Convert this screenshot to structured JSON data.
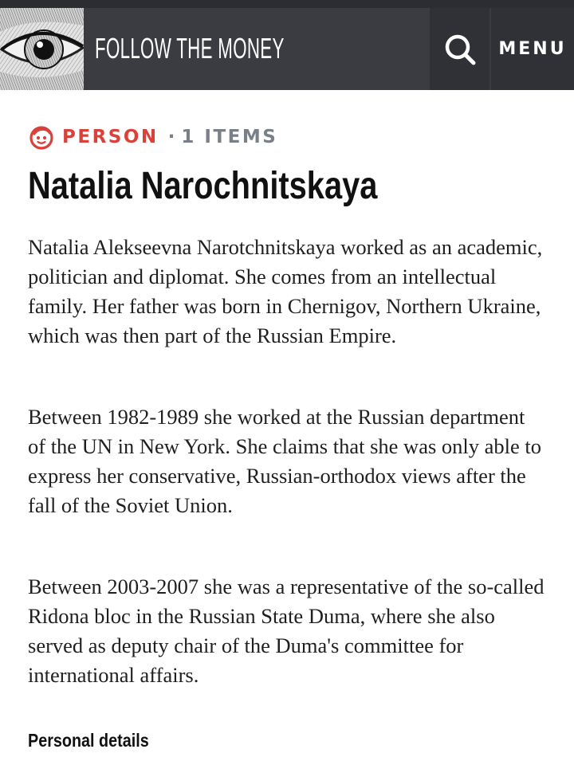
{
  "header": {
    "site_title": "FOLLOW THE MONEY",
    "search_icon": "search-icon",
    "menu_label": "MENU",
    "logo_image": "eye-banknote-engraving",
    "colors": {
      "bar": "#3a3c41",
      "buttons": "#2f3136",
      "text": "#ffffff"
    }
  },
  "entity": {
    "type_icon": "person-face-icon",
    "type_label": "PERSON",
    "separator": "·",
    "count_label": "1 ITEMS",
    "name": "Natalia Narochnitskaya",
    "accent_color": "#d9423a"
  },
  "body": {
    "paragraphs": [
      "Natalia Alekseevna Narotchnitskaya worked as an academic, politician and diplomat. She comes from an intellectual family. Her father was born in Chernigov, Northern Ukraine, which was then part of the Russian Empire.",
      "Between 1982-1989 she worked at the Russian department of the UN in New York. She claims that she was only able to express her conservative, Russian-orthodox views after the fall of the Soviet Union.",
      "Between 2003-2007 she was a representative of the so-called Ridona bloc in the Russian State Duma, where she also served as deputy chair of the Duma's committee for international affairs."
    ]
  },
  "sections": {
    "personal_details": "Personal details"
  }
}
